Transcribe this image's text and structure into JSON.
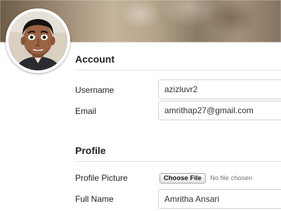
{
  "account": {
    "title": "Account",
    "username_label": "Username",
    "username_value": "azizluvr2",
    "email_label": "Email",
    "email_value": "amrithap27@gmail.com"
  },
  "profile": {
    "title": "Profile",
    "picture_label": "Profile Picture",
    "choose_file_label": "Choose File",
    "file_status": "No file chosen",
    "fullname_label": "Full Name",
    "fullname_value": "Amritha Ansari"
  }
}
